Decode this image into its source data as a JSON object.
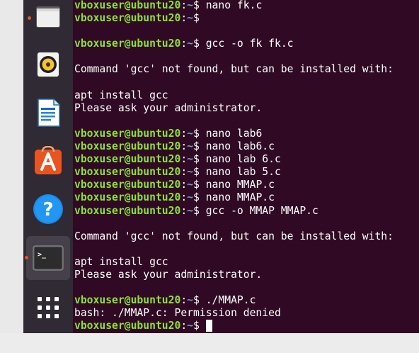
{
  "dock": {
    "items": [
      {
        "name": "files",
        "icon": "folder-icon",
        "running": true
      },
      {
        "name": "rhythmbox",
        "icon": "speaker-icon",
        "running": false
      },
      {
        "name": "libreoffice-writer",
        "icon": "document-icon",
        "running": false
      },
      {
        "name": "ubuntu-software",
        "icon": "shopping-bag-icon",
        "running": false
      },
      {
        "name": "help",
        "icon": "question-icon",
        "running": false
      },
      {
        "name": "terminal",
        "icon": "terminal-icon",
        "running": true,
        "active": true
      },
      {
        "name": "show-applications",
        "icon": "app-grid-icon",
        "running": false
      }
    ],
    "terminal_icon_glyph": ">_"
  },
  "terminal": {
    "user_host": "vboxuser@ubuntu20",
    "path": "~",
    "prompt_symbol": "$",
    "lines": [
      {
        "type": "prompt",
        "cmd": " nano fk.c"
      },
      {
        "type": "prompt",
        "cmd": ""
      },
      {
        "type": "blank"
      },
      {
        "type": "prompt",
        "cmd": " gcc -o fk fk.c"
      },
      {
        "type": "blank"
      },
      {
        "type": "output",
        "text": "Command 'gcc' not found, but can be installed with:"
      },
      {
        "type": "blank"
      },
      {
        "type": "output",
        "text": "apt install gcc"
      },
      {
        "type": "output",
        "text": "Please ask your administrator."
      },
      {
        "type": "blank"
      },
      {
        "type": "prompt",
        "cmd": " nano lab6"
      },
      {
        "type": "prompt",
        "cmd": " nano lab6.c"
      },
      {
        "type": "prompt",
        "cmd": " nano lab 6.c"
      },
      {
        "type": "prompt",
        "cmd": " nano lab 5.c"
      },
      {
        "type": "prompt",
        "cmd": " nano MMAP.c"
      },
      {
        "type": "prompt",
        "cmd": " nano MMAP.c"
      },
      {
        "type": "prompt",
        "cmd": " gcc -o MMAP MMAP.c"
      },
      {
        "type": "blank"
      },
      {
        "type": "output",
        "text": "Command 'gcc' not found, but can be installed with:"
      },
      {
        "type": "blank"
      },
      {
        "type": "output",
        "text": "apt install gcc"
      },
      {
        "type": "output",
        "text": "Please ask your administrator."
      },
      {
        "type": "blank"
      },
      {
        "type": "prompt",
        "cmd": " ./MMAP.c"
      },
      {
        "type": "output",
        "text": "bash: ./MMAP.c: Permission denied"
      },
      {
        "type": "prompt",
        "cmd": " ",
        "cursor": true
      }
    ]
  },
  "colors": {
    "terminal_bg": "#300a24",
    "user_host": "#8ae234",
    "path": "#729fcf",
    "dock_bg": "#2f2a33",
    "accent": "#e95420"
  }
}
